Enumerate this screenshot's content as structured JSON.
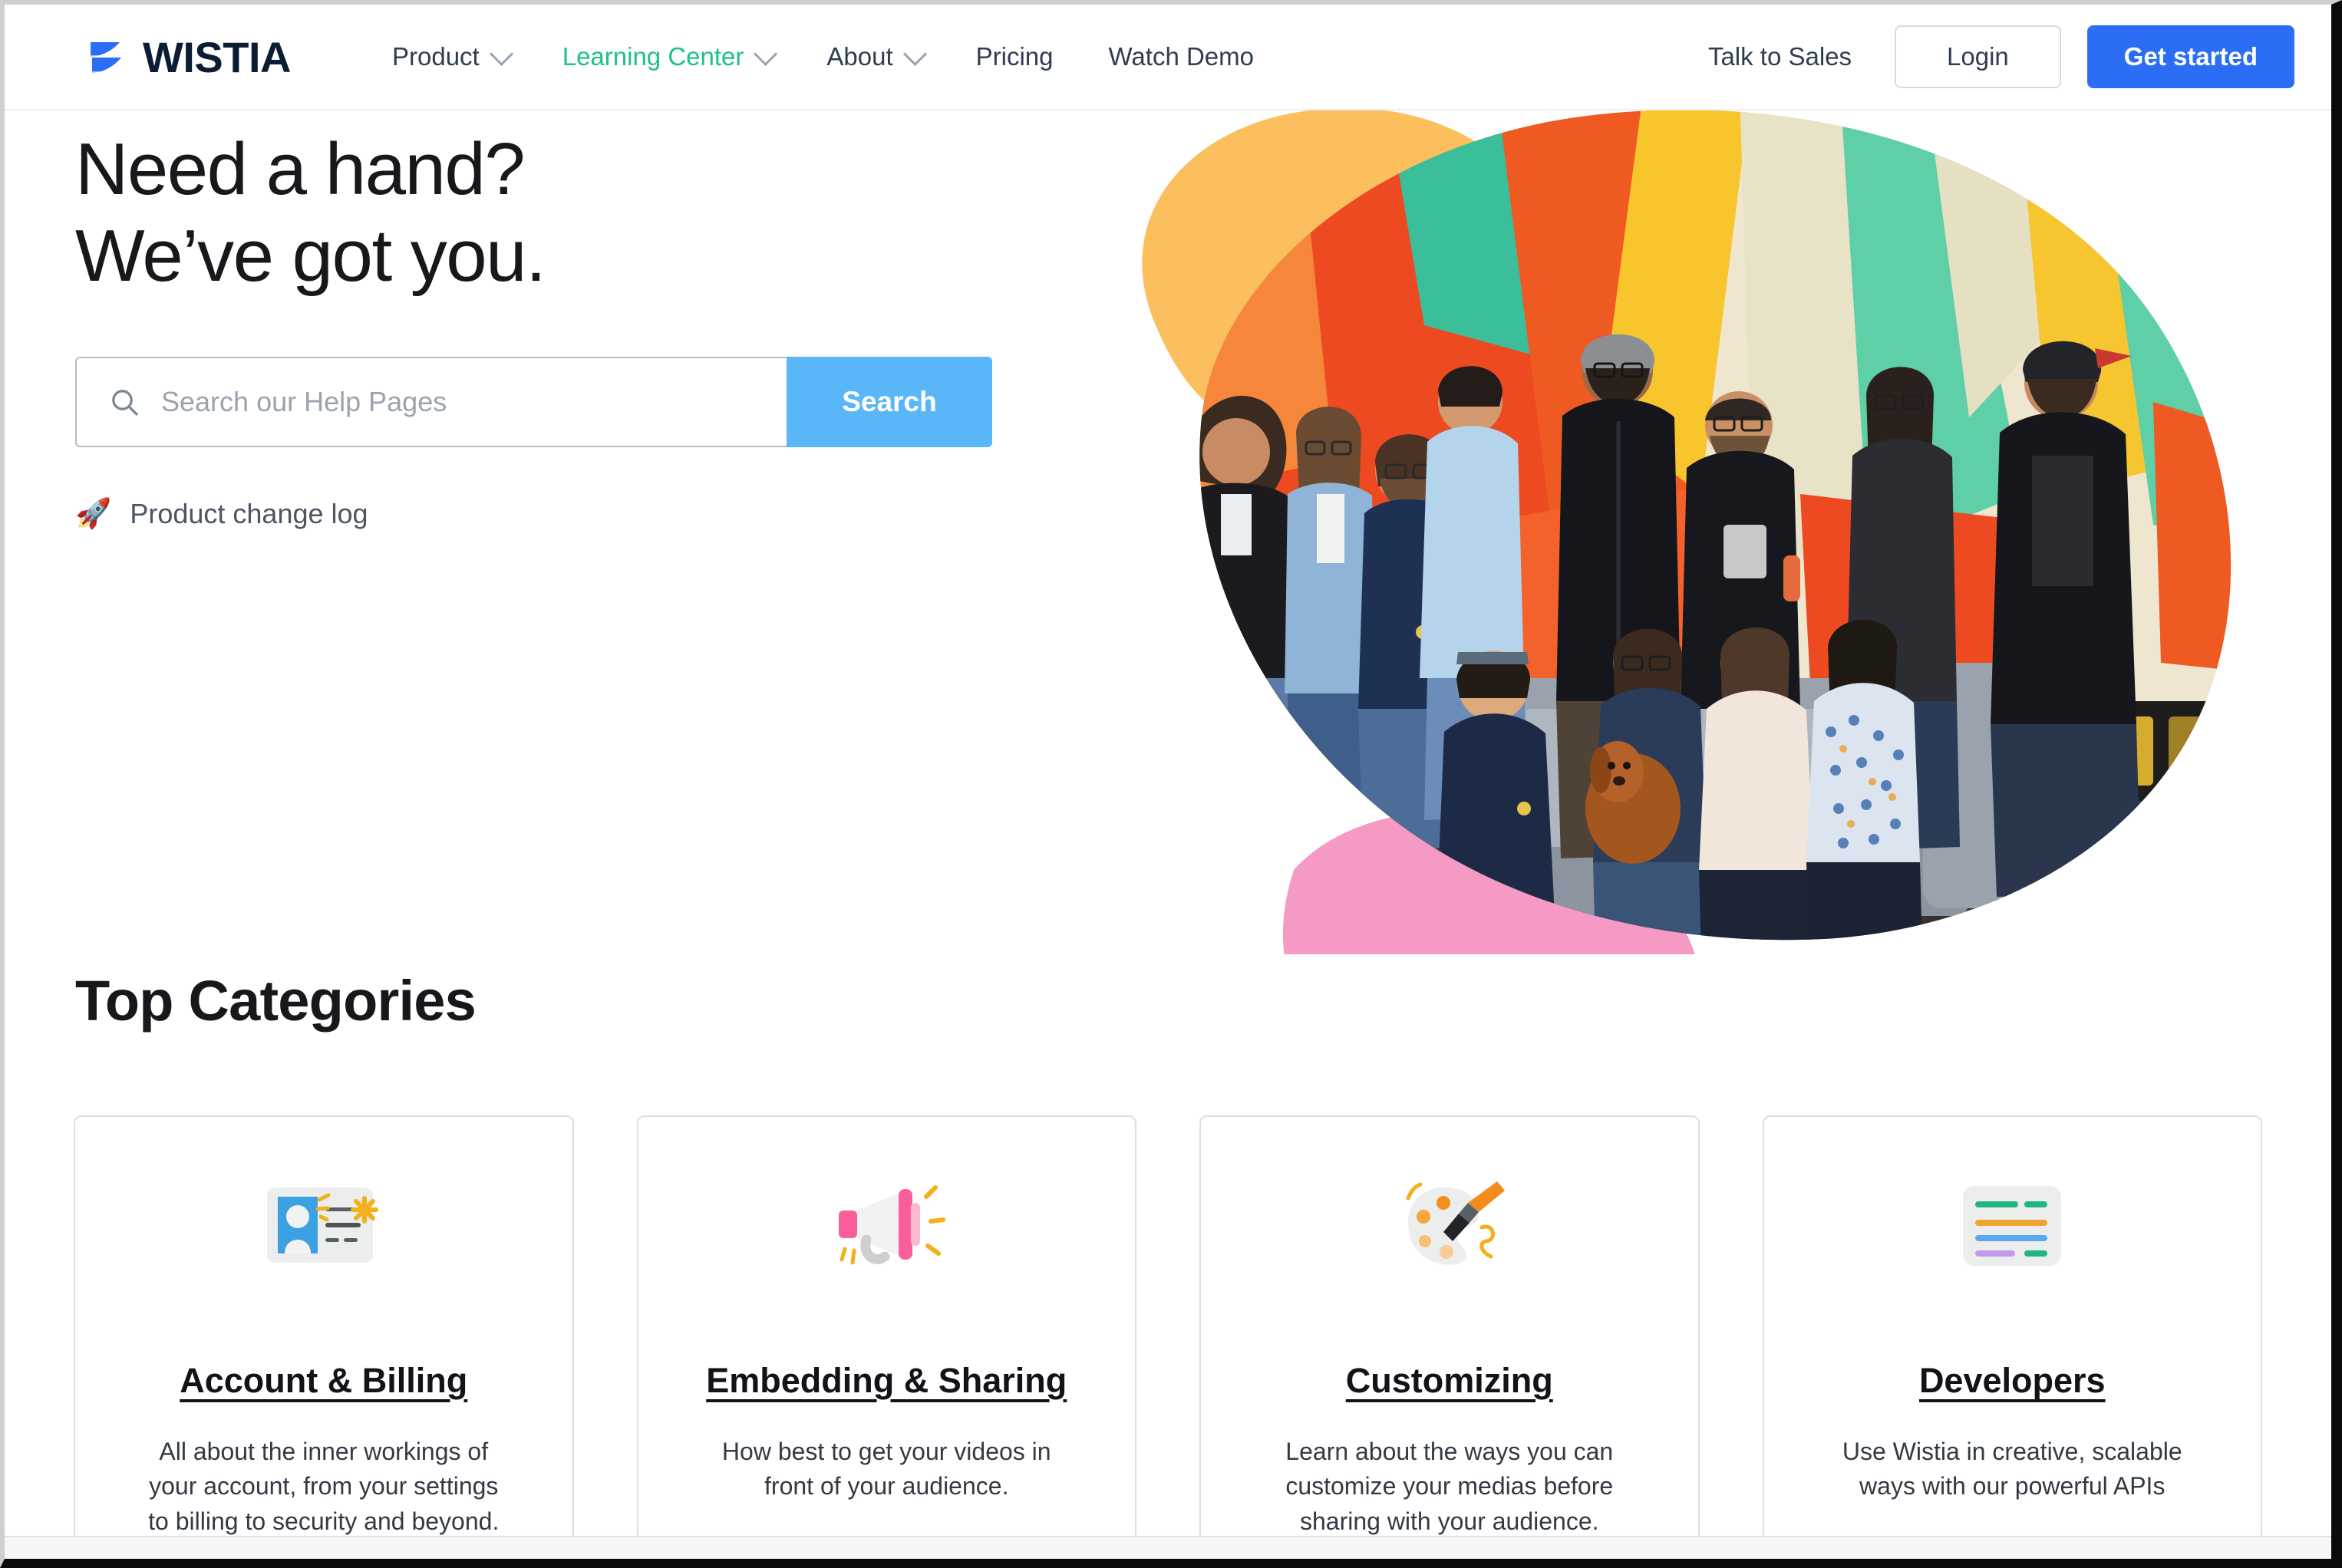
{
  "header": {
    "logo": {
      "icon": "wistia-logo-mark",
      "text": "WISTIA",
      "color": "#2b6ef5"
    },
    "nav": [
      {
        "label": "Product",
        "has_dropdown": true,
        "active": false
      },
      {
        "label": "Learning Center",
        "has_dropdown": true,
        "active": true
      },
      {
        "label": "About",
        "has_dropdown": true,
        "active": false
      },
      {
        "label": "Pricing",
        "has_dropdown": false,
        "active": false
      },
      {
        "label": "Watch Demo",
        "has_dropdown": false,
        "active": false
      }
    ],
    "talk_to_sales": "Talk to Sales",
    "login_label": "Login",
    "get_started_label": "Get started",
    "accent_color": "#1cc286",
    "brand_blue": "#2b6ef5"
  },
  "hero": {
    "title_line1": "Need a hand?",
    "title_line2": "We’ve got you.",
    "search": {
      "icon": "search-icon",
      "placeholder": "Search our Help Pages",
      "value": "",
      "button_label": "Search",
      "button_color": "#5ab7f7"
    },
    "changelog": {
      "icon": "rocket-icon",
      "glyph": "🚀",
      "label": "Product change log"
    },
    "art": {
      "alt": "Wistia team group photo on colorful geometric mural",
      "blob_orange": "#fbbf5e",
      "blob_pink": "#f49ac4"
    }
  },
  "categories_section": {
    "heading": "Top Categories",
    "cards": [
      {
        "icon": "id-card-icon",
        "title": "Account & Billing",
        "description": "All about the inner workings of your account, from your settings to billing to security and beyond."
      },
      {
        "icon": "megaphone-icon",
        "title": "Embedding & Sharing",
        "description": "How best to get your videos in front of your audience."
      },
      {
        "icon": "paint-palette-icon",
        "title": "Customizing",
        "description": "Learn about the ways you can customize your medias before sharing with your audience."
      },
      {
        "icon": "code-lines-icon",
        "title": "Developers",
        "description": "Use Wistia in creative, scalable ways with our powerful APIs"
      }
    ]
  }
}
